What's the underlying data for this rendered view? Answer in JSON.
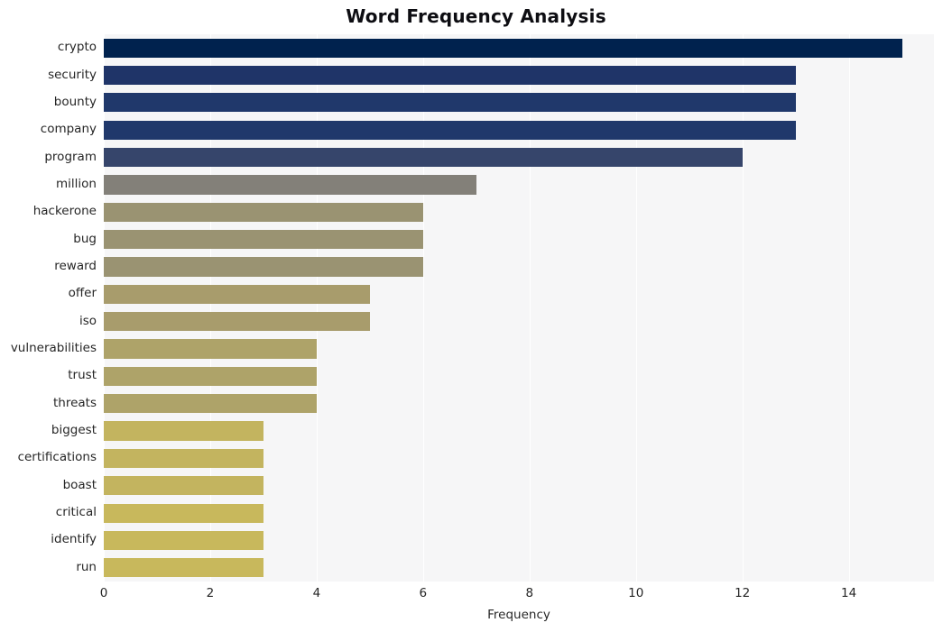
{
  "chart_data": {
    "type": "bar",
    "orientation": "horizontal",
    "title": "Word Frequency Analysis",
    "xlabel": "Frequency",
    "ylabel": "",
    "categories": [
      "crypto",
      "security",
      "bounty",
      "company",
      "program",
      "million",
      "hackerone",
      "bug",
      "reward",
      "offer",
      "iso",
      "vulnerabilities",
      "trust",
      "threats",
      "biggest",
      "certifications",
      "boast",
      "critical",
      "identify",
      "run"
    ],
    "values": [
      15,
      13,
      13,
      13,
      12,
      7,
      6,
      6,
      6,
      5,
      5,
      4,
      4,
      4,
      3,
      3,
      3,
      3,
      3,
      3
    ],
    "bar_colors": [
      "#00224e",
      "#1f3468",
      "#20386b",
      "#20386b",
      "#36456b",
      "#838079",
      "#9a9372",
      "#9a9372",
      "#9a9372",
      "#a89c6c",
      "#a89c6c",
      "#aea369",
      "#aea369",
      "#aea369",
      "#c3b45f",
      "#c3b45f",
      "#c3b45f",
      "#c8b85c",
      "#c8b85c",
      "#c8b85c"
    ],
    "xticks": [
      0,
      2,
      4,
      6,
      8,
      10,
      12,
      14
    ],
    "xlim": [
      0,
      15.6
    ],
    "grid": "vertical",
    "legend": null,
    "plot_background": "#f6f6f7",
    "gridline_color": "#ffffff",
    "figure_background": "#ffffff"
  }
}
